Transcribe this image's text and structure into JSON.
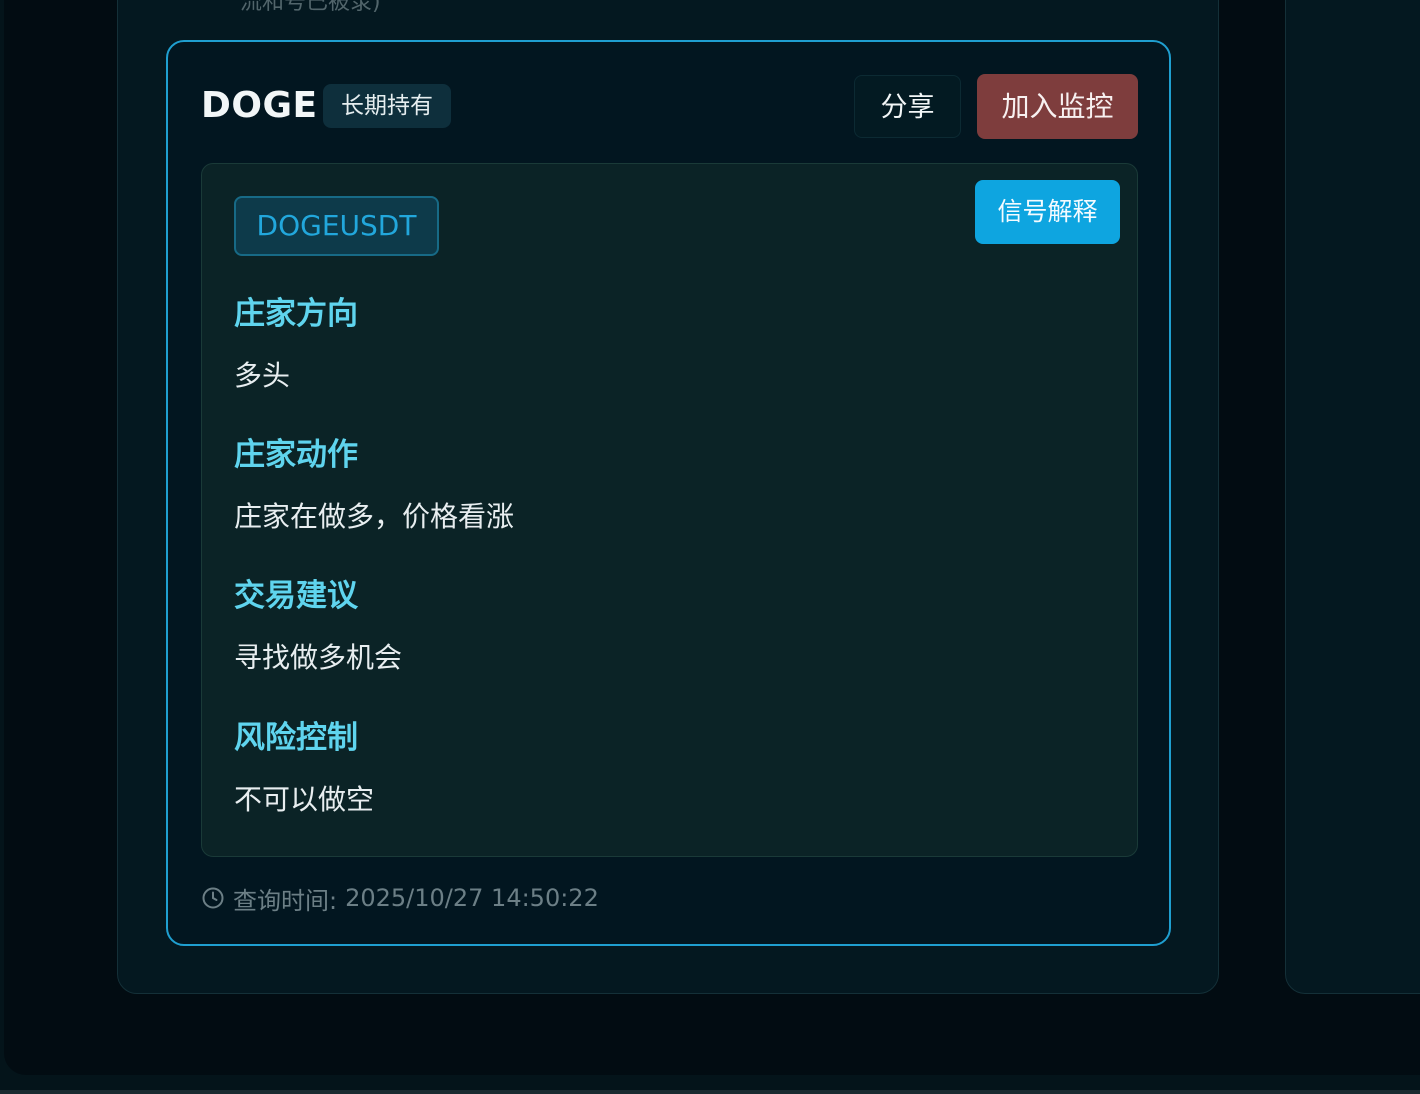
{
  "page": {
    "top_cut_text": "流和号已被录)"
  },
  "card": {
    "coin": "DOGE",
    "hold_tag": "长期持有",
    "share_label": "分享",
    "monitor_label": "加入监控",
    "symbol": "DOGEUSDT",
    "explain_label": "信号解释",
    "sections": [
      {
        "heading": "庄家方向",
        "body": "多头"
      },
      {
        "heading": "庄家动作",
        "body": "庄家在做多，价格看涨"
      },
      {
        "heading": "交易建议",
        "body": "寻找做多机会"
      },
      {
        "heading": "风险控制",
        "body": "不可以做空"
      }
    ],
    "query_time_label": "查询时间:",
    "query_time_value": "2025/10/27 14:50:22"
  },
  "colors": {
    "card_border": "#1f9fd0",
    "heading": "#5fd4ee",
    "monitor_button": "#7e3d3d",
    "explain_button": "#0ea5e0",
    "symbol_text": "#22a7dc"
  },
  "icons": {
    "clock": "clock-icon"
  }
}
